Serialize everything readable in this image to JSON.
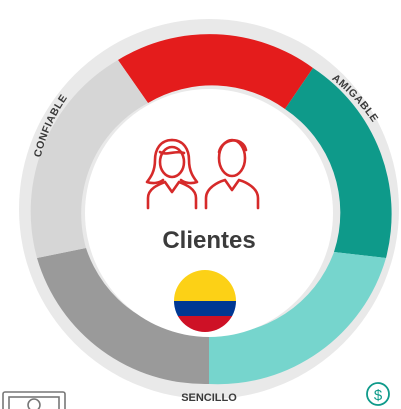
{
  "center": {
    "title": "Clientes",
    "icon": "users-icon",
    "flag": "colombia-flag-icon",
    "flag_colors": [
      "#FCD116",
      "#003893",
      "#CE1126"
    ]
  },
  "ring": [
    {
      "label": "",
      "color": "#e41c1c"
    },
    {
      "label": "AMIGABLE",
      "color": "#0e9a8a"
    },
    {
      "label": "",
      "color": "#76d5cd"
    },
    {
      "label": "SENCILLO",
      "color": "#c8c8c8"
    },
    {
      "label": "",
      "color": "#9a9a9a"
    },
    {
      "label": "CONFIABLE",
      "color": "#d6d6d6"
    }
  ],
  "accent": "#d62a2a",
  "corner_icons": [
    "money-bill-icon",
    "dollar-coin-icon"
  ]
}
